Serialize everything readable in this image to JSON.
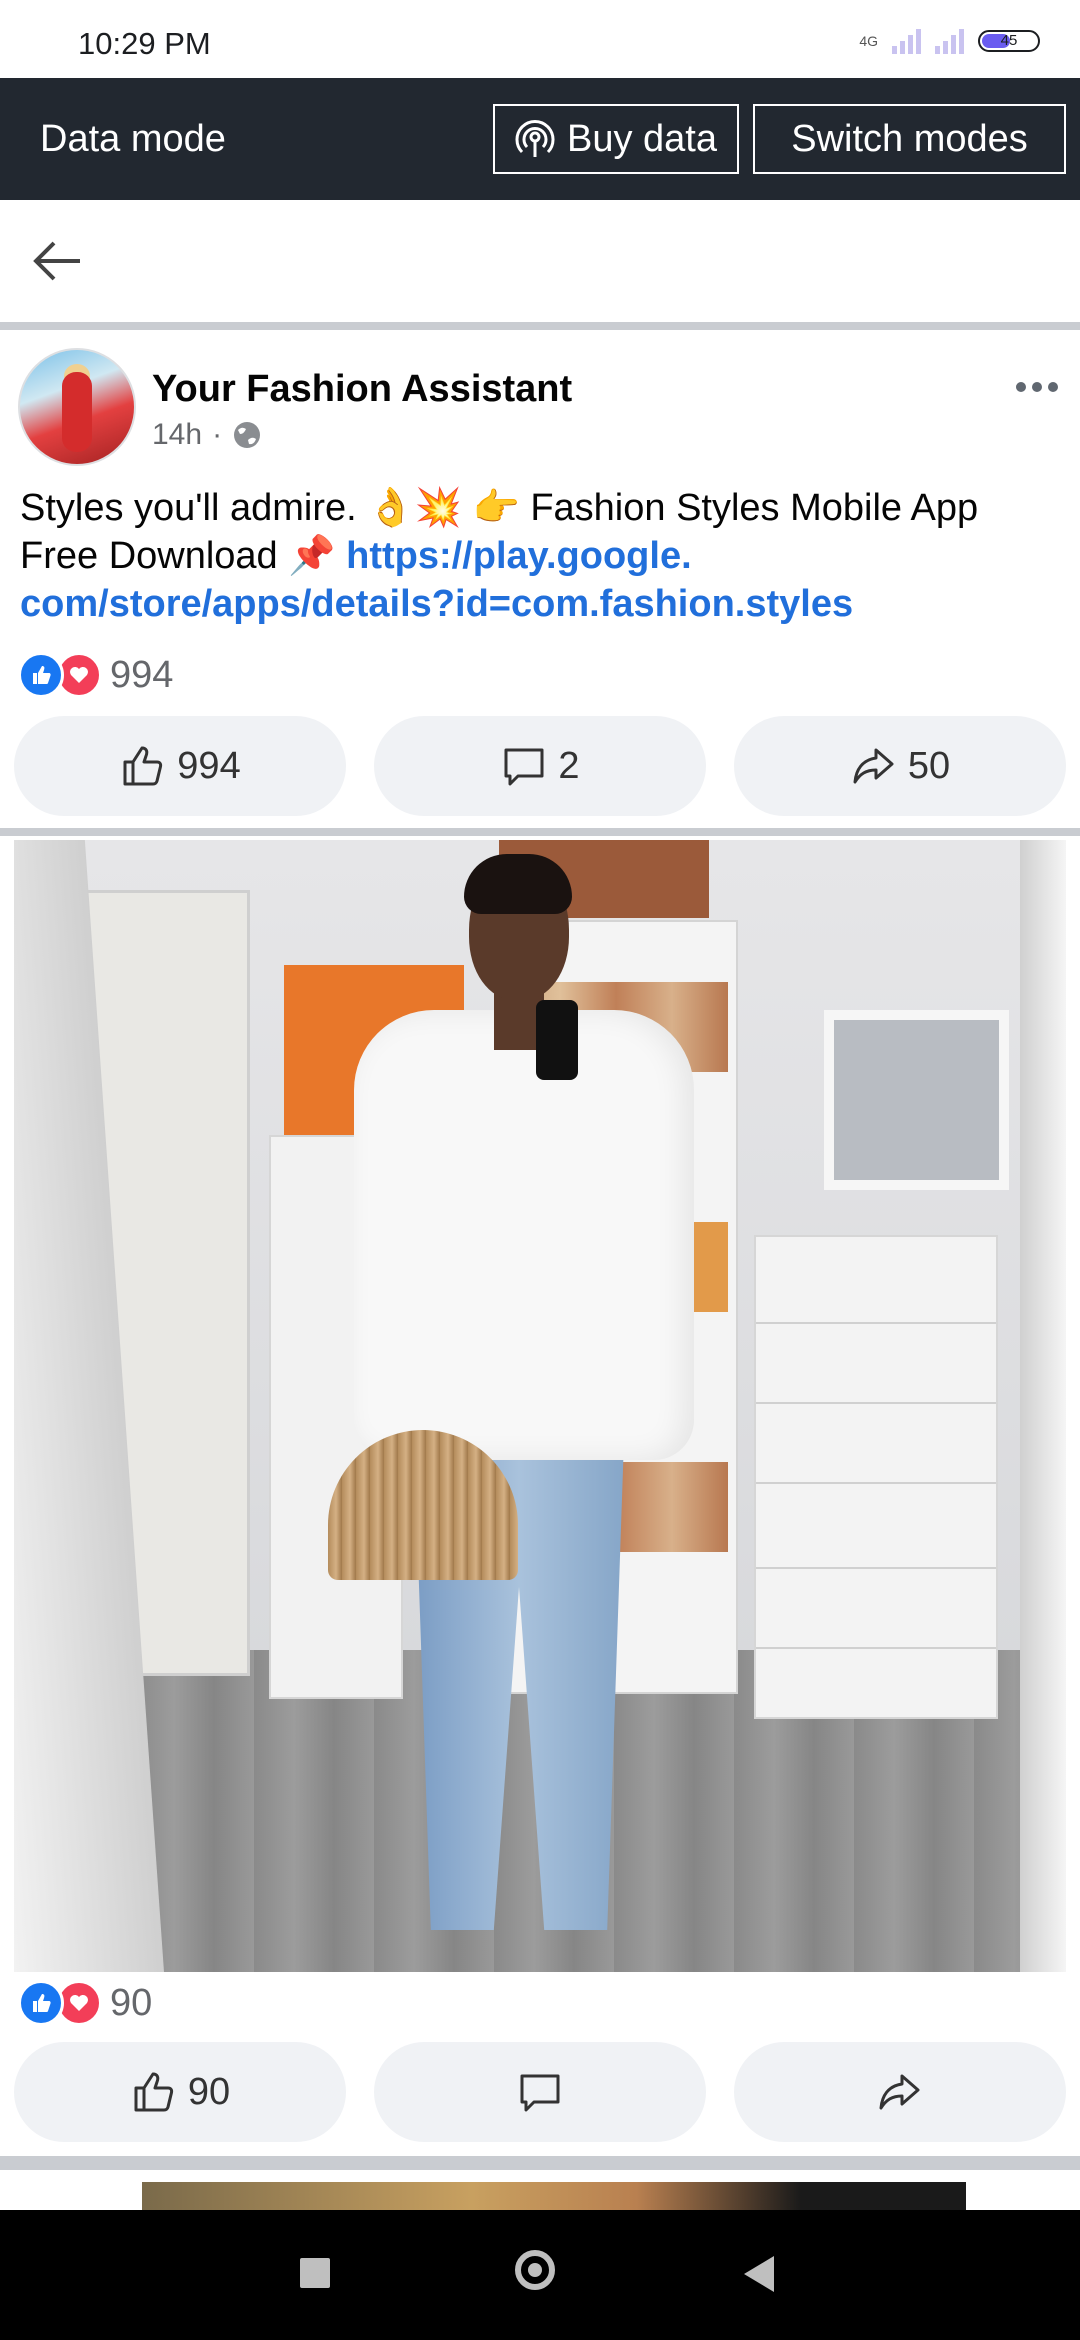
{
  "status_bar": {
    "time": "10:29 PM",
    "network": "4G",
    "battery": "45"
  },
  "data_mode_bar": {
    "title": "Data mode",
    "buy_data_label": "Buy data",
    "switch_modes_label": "Switch modes"
  },
  "post1": {
    "author": "Your Fashion Assistant",
    "time": "14h",
    "text_before_link": "Styles you'll admire. 👌💥 👉 Fashion Styles Mobile App Free Download 📌 ",
    "link": "https://play.google. com/store/apps/details?id=com.fashion.styles",
    "reaction_count": "994",
    "like_count": "994",
    "comment_count": "2",
    "share_count": "50"
  },
  "post2": {
    "reaction_count": "90",
    "like_count": "90"
  },
  "icons": [
    "back-arrow-icon",
    "globe-icon",
    "more-icon",
    "like-icon",
    "comment-icon",
    "share-icon",
    "love-icon",
    "broadcast-icon"
  ],
  "colors": {
    "accent": "#1877f2",
    "link": "#216fdb",
    "love": "#f33e58",
    "data_bar": "#222830"
  }
}
